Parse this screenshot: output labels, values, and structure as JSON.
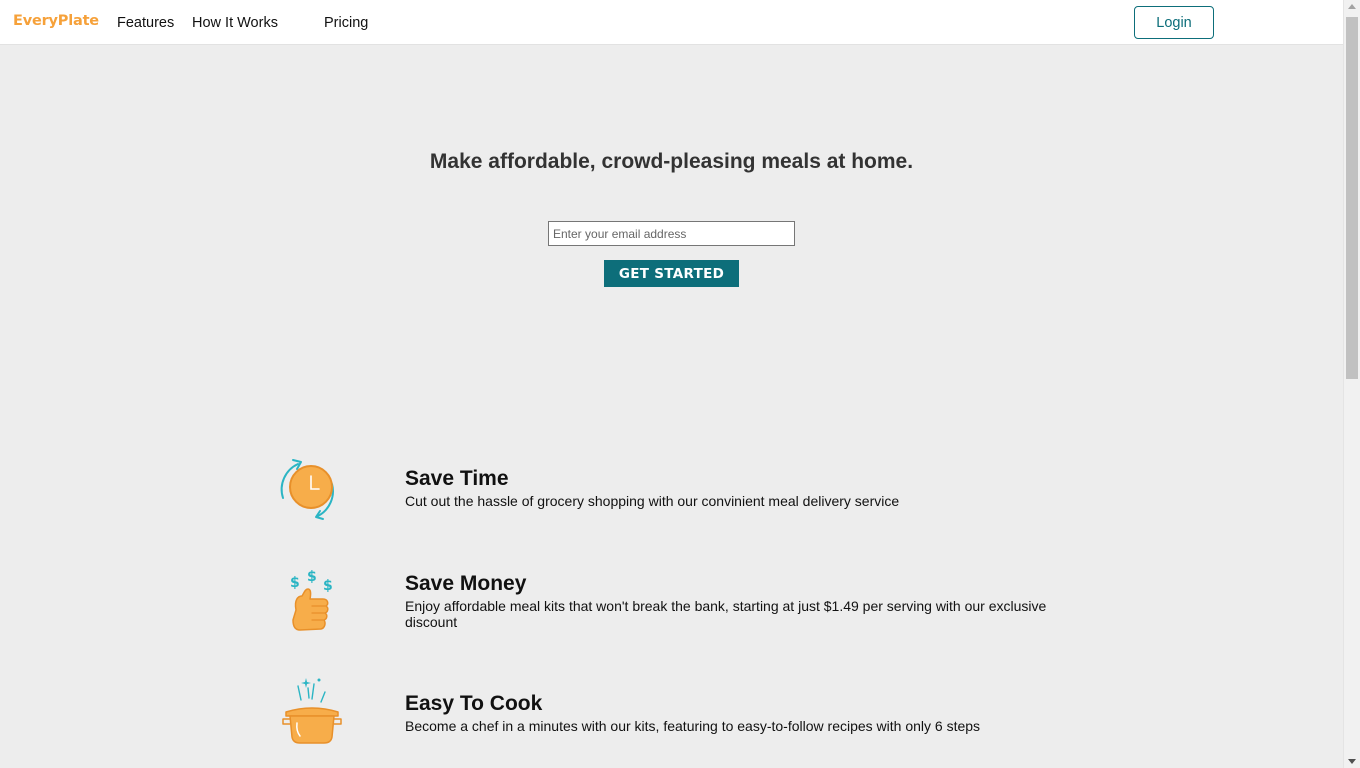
{
  "nav": {
    "logo": "EveryPlate",
    "links": [
      "Features",
      "How It Works",
      "Pricing"
    ],
    "login_label": "Login"
  },
  "hero": {
    "title": "Make affordable, crowd-pleasing meals at home.",
    "email_placeholder": "Enter your email address",
    "email_value": "",
    "cta_label": "GET STARTED"
  },
  "features": [
    {
      "icon": "clock-icon",
      "title": "Save Time",
      "description": "Cut out the hassle of grocery shopping with our convinient meal delivery service"
    },
    {
      "icon": "thumbs-up-money-icon",
      "title": "Save Money",
      "description": "Enjoy affordable meal kits that won't break the bank, starting at just $1.49 per serving with our exclusive discount"
    },
    {
      "icon": "cooking-pot-icon",
      "title": "Easy To Cook",
      "description": "Become a chef in a minutes with our kits, featuring to easy-to-follow recipes with only 6 steps"
    }
  ],
  "colors": {
    "brand_orange": "#f6a13a",
    "accent_teal": "#0d6e7a",
    "icon_teal": "#2bb5c4",
    "page_background": "#ededed"
  }
}
